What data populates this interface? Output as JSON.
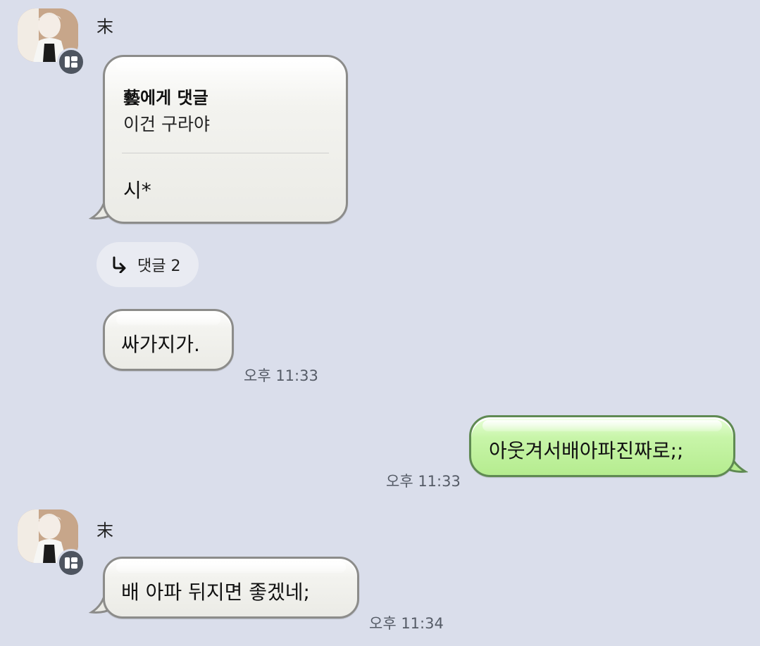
{
  "messages": [
    {
      "sender": "末",
      "comment": {
        "header": "藝에게 댓글",
        "quoted": "이건 구라야",
        "body": "시*"
      },
      "reply_link": "댓글 2"
    },
    {
      "text": "싸가지가.",
      "time": "오후 11:33"
    },
    {
      "text": "아웃겨서배아파진짜로;;",
      "time": "오후 11:33",
      "mine": true
    },
    {
      "sender": "末",
      "text": "배 아파 뒤지면 좋겠네;",
      "time": "오후 11:34"
    }
  ],
  "colors": {
    "background": "#dadeeb",
    "my_bubble": "#c8f5a9",
    "their_bubble": "#efefeb",
    "badge": "#4e5560"
  },
  "icons": [
    "profile-avatar",
    "app-badge-icon",
    "reply-arrow-icon"
  ]
}
